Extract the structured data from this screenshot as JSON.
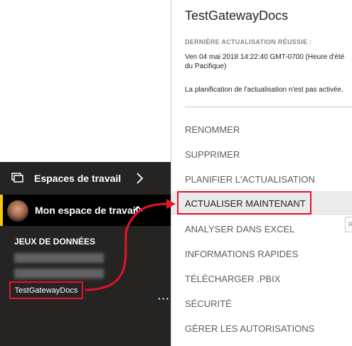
{
  "nav": {
    "workspaces_label": "Espaces de travail",
    "my_workspace_label": "Mon espace de travail",
    "datasets_heading": "JEUX DE DONNÉES",
    "dataset_selected": "TestGatewayDocs",
    "ellipsis": "···"
  },
  "flyout": {
    "title": "TestGatewayDocs",
    "last_refresh_label": "DERNIÈRE ACTUALISATION RÉUSSIE :",
    "last_refresh_date": "Ven 04 mai 2018 14:22:40 GMT-0700 (Heure d'été du Pacifique)",
    "schedule_note": "La planification de l'actualisation n'est pas activée.",
    "menu": [
      {
        "label": "RENOMMER"
      },
      {
        "label": "SUPPRIMER"
      },
      {
        "label": "PLANIFIER L'ACTUALISATION"
      },
      {
        "label": "ACTUALISER MAINTENANT"
      },
      {
        "label": "ANALYSER DANS EXCEL"
      },
      {
        "label": "INFORMATIONS RAPIDES"
      },
      {
        "label": "TÉLÉCHARGER .PBIX"
      },
      {
        "label": "SÉCURITÉ"
      },
      {
        "label": "GÉRER LES AUTORISATIONS"
      }
    ],
    "scroll_hint": "R"
  },
  "colors": {
    "nav_bg": "#252423",
    "accent_yellow": "#f2c811",
    "highlight_red": "#e8112d"
  }
}
